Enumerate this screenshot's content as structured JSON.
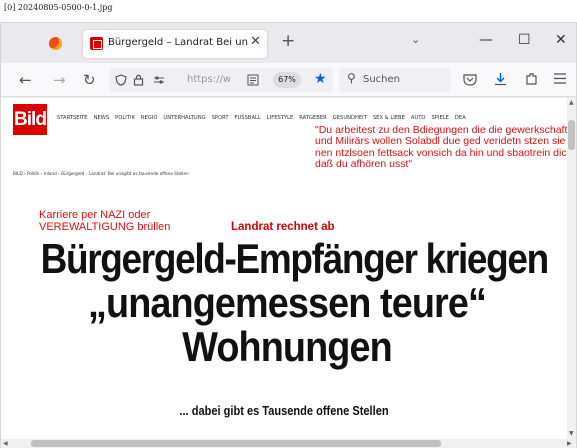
{
  "filename": "[0] 20240805-0500-0-1.jpg",
  "browser": {
    "tab_title": "Bürgergeld – Landrat Bei unsg",
    "tab_close": "✕",
    "new_tab": "+",
    "list_all_tabs": "⌄",
    "minimize": "—",
    "maximize": "☐",
    "close": "✕",
    "back": "←",
    "forward": "→",
    "reload": "↻",
    "url_text": "https://w",
    "zoom": "67%",
    "search_label": "Suchen"
  },
  "page": {
    "logo": "Bild",
    "menu": [
      "STARTSEITE",
      "NEWS",
      "POLITIK",
      "REGIO",
      "UNTERHALTUNG",
      "SPORT",
      "FUSSBALL",
      "LIFESTYLE",
      "RATGEBER",
      "GESUNDHEIT",
      "SEX & LIEBE",
      "AUTO",
      "SPIELE",
      "DEA"
    ],
    "breadcrumb": "BILD › Politik › Inland › Bürgergeld – Landrat: Bei unsgibt es tausende offene Stellen",
    "annotation_right": "\"Du arbeitest zu den Bdiegungen die die gewerkschaft und Milirärs wollen Solabdl due ged veridetn stzen sie nen ntzlsoen fettsack vonsich da hin und sbaotrein dich daß du afhören usst\"",
    "annotation_left": "Karriere per NAZI oder VEREWALTIGUNG brüllen",
    "kicker": "Landrat rechnet ab",
    "headline_1": "Bürgergeld-Empfänger kriegen",
    "headline_2": "„unangemessen teure“",
    "headline_3": "Wohnungen",
    "subline": "... dabei gibt es Tausende offene Stellen"
  },
  "colors": {
    "bild_red": "#dd0000",
    "annotation_red": "#e01010",
    "firefox_blue": "#0060df"
  }
}
